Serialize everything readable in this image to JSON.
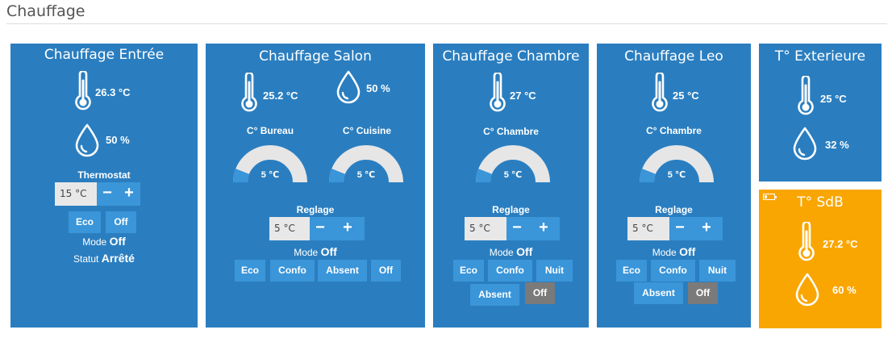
{
  "page": {
    "title": "Chauffage"
  },
  "colors": {
    "card": "#2a7ec0",
    "card_warning": "#f9a602",
    "button": "#3a95d9",
    "button_active": "#7a7a7a",
    "gauge_track": "#e6e6e6",
    "gauge_fill": "#3a95d9"
  },
  "icons": {
    "temperature": "thermometer-icon",
    "humidity": "water-drop-icon",
    "battery": "battery-low-icon"
  },
  "cards": {
    "entree": {
      "title": "Chauffage Entrée",
      "temperature": "26.3 °C",
      "humidity": "50 %",
      "thermostat_label": "Thermostat",
      "setpoint": "15 °C",
      "minus": "−",
      "plus": "+",
      "buttons": [
        "Eco",
        "Off"
      ],
      "mode_label": "Mode",
      "mode_value": "Off",
      "statut_label": "Statut",
      "statut_value": "Arrêté"
    },
    "salon": {
      "title": "Chauffage Salon",
      "temperature": "25.2 °C",
      "humidity": "50 %",
      "gauges": [
        {
          "label": "C° Bureau",
          "value": "5 ℃",
          "level": 0.12
        },
        {
          "label": "C° Cuisine",
          "value": "5 ℃",
          "level": 0.12
        }
      ],
      "reglage_label": "Reglage",
      "setpoint": "5 °C",
      "minus": "−",
      "plus": "+",
      "mode_label": "Mode",
      "mode_value": "Off",
      "buttons": [
        "Eco",
        "Confo",
        "Absent",
        "Off"
      ]
    },
    "chambre": {
      "title": "Chauffage Chambre",
      "temperature": "27 °C",
      "gauge": {
        "label": "C° Chambre",
        "value": "5 ℃",
        "level": 0.12
      },
      "reglage_label": "Reglage",
      "setpoint": "5 °C",
      "minus": "−",
      "plus": "+",
      "mode_label": "Mode",
      "mode_value": "Off",
      "buttons": [
        "Eco",
        "Confo",
        "Nuit",
        "Absent",
        "Off"
      ],
      "active_button": "Off"
    },
    "leo": {
      "title": "Chauffage Leo",
      "temperature": "25 °C",
      "gauge": {
        "label": "C° Chambre",
        "value": "5 ℃",
        "level": 0.12
      },
      "reglage_label": "Reglage",
      "setpoint": "5 °C",
      "minus": "−",
      "plus": "+",
      "mode_label": "Mode",
      "mode_value": "Off",
      "buttons": [
        "Eco",
        "Confo",
        "Nuit",
        "Absent",
        "Off"
      ],
      "active_button": "Off"
    },
    "exterieur": {
      "title": "T° Exterieure",
      "temperature": "25 °C",
      "humidity": "32 %"
    },
    "sdb": {
      "title": "T° SdB",
      "temperature": "27.2 °C",
      "humidity": "60 %"
    }
  }
}
